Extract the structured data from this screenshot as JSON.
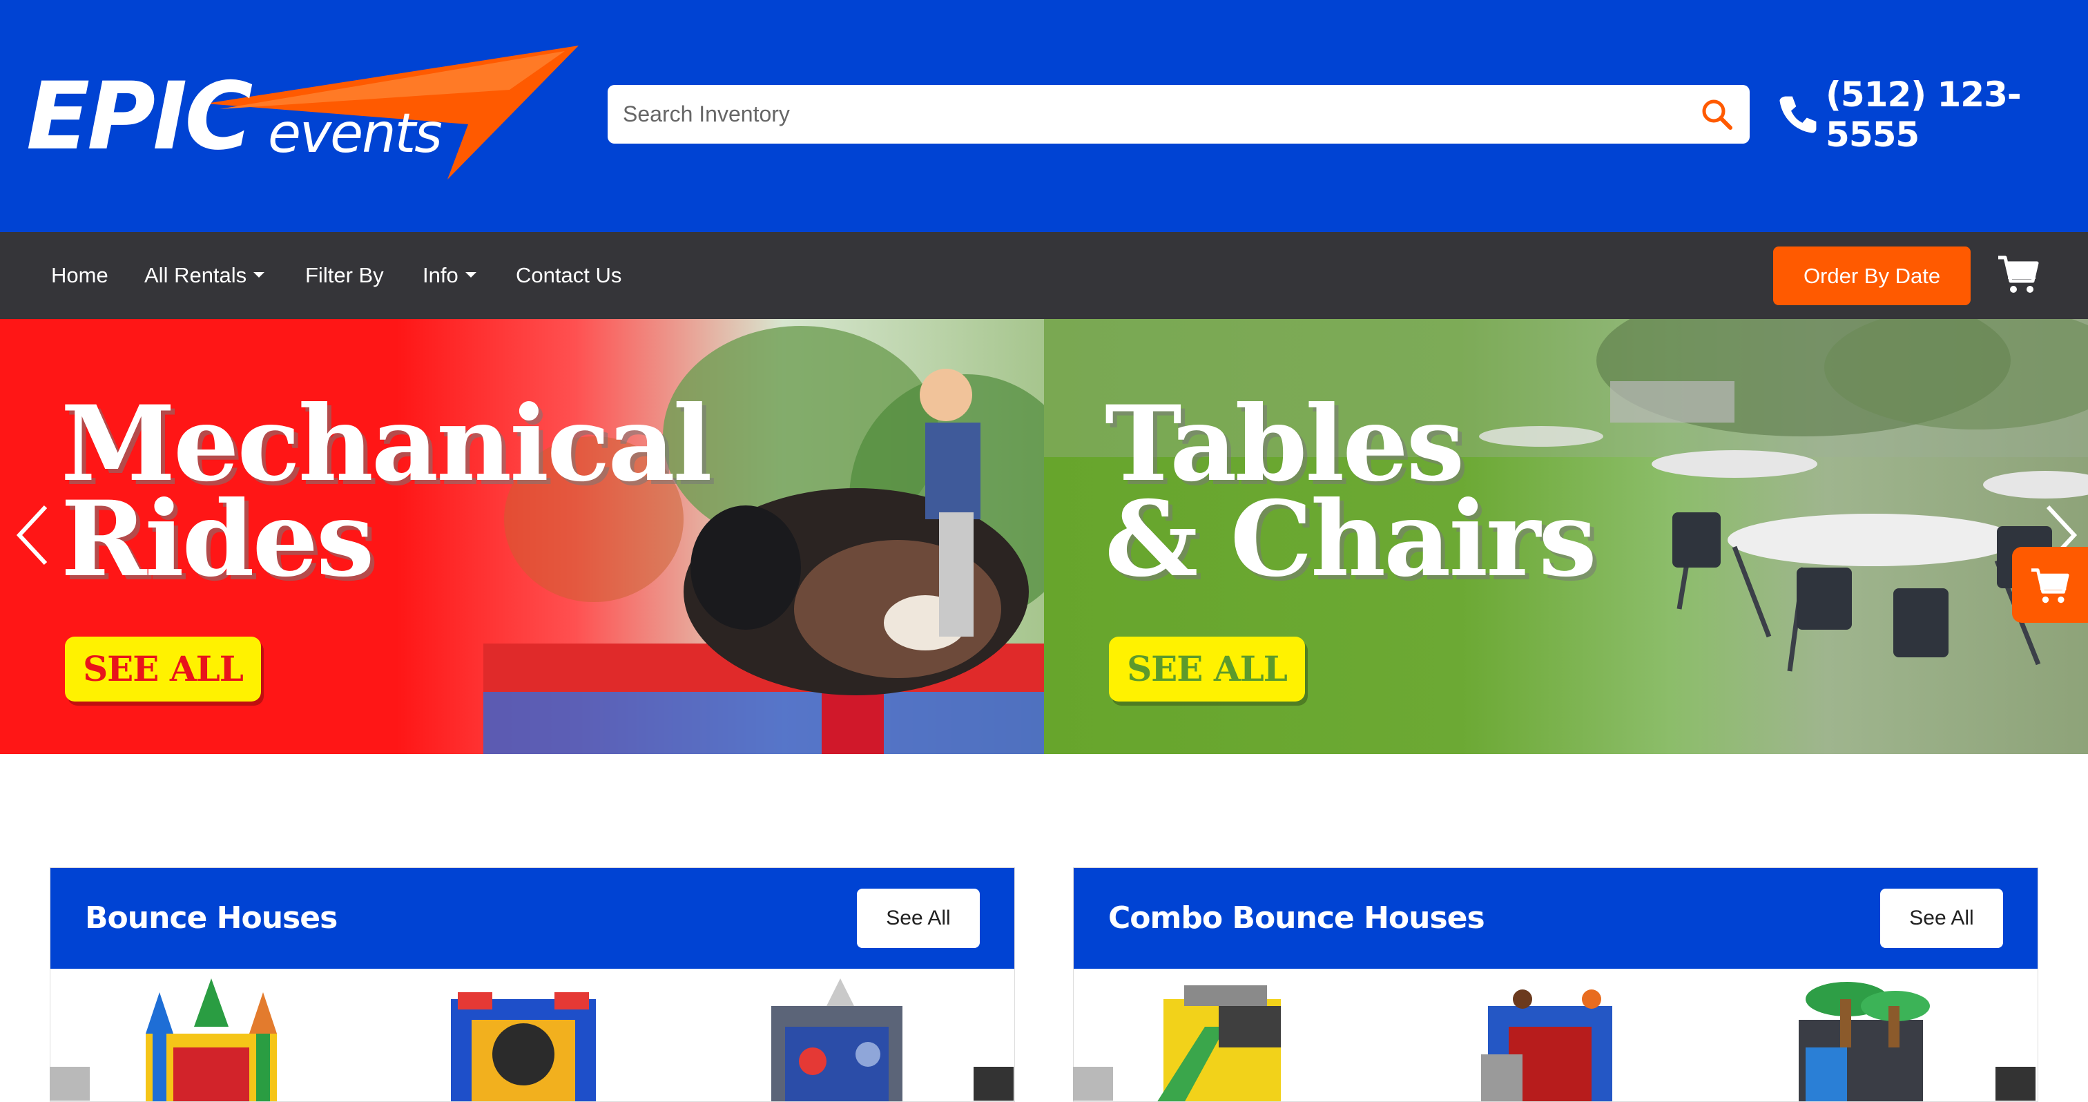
{
  "header": {
    "logo_text": "EPIC events",
    "search_placeholder": "Search Inventory",
    "phone": "(512) 123-5555"
  },
  "nav": {
    "items": [
      {
        "label": "Home"
      },
      {
        "label": "All Rentals"
      },
      {
        "label": "Filter By"
      },
      {
        "label": "Info"
      },
      {
        "label": "Contact Us"
      }
    ],
    "order_button": "Order By Date"
  },
  "slides": [
    {
      "title_line1": "Mechanical",
      "title_line2": "Rides",
      "button": "SEE ALL",
      "button_color": "#e8141b"
    },
    {
      "title_line1": "Tables",
      "title_line2": "& Chairs",
      "button": "SEE ALL",
      "button_color": "#5c9a2c"
    }
  ],
  "categories": [
    {
      "title": "Bounce Houses",
      "button": "See All"
    },
    {
      "title": "Combo Bounce Houses",
      "button": "See All"
    }
  ],
  "colors": {
    "brand_blue": "#0043d3",
    "accent_orange": "#ff5a00",
    "nav_dark": "#353539"
  }
}
